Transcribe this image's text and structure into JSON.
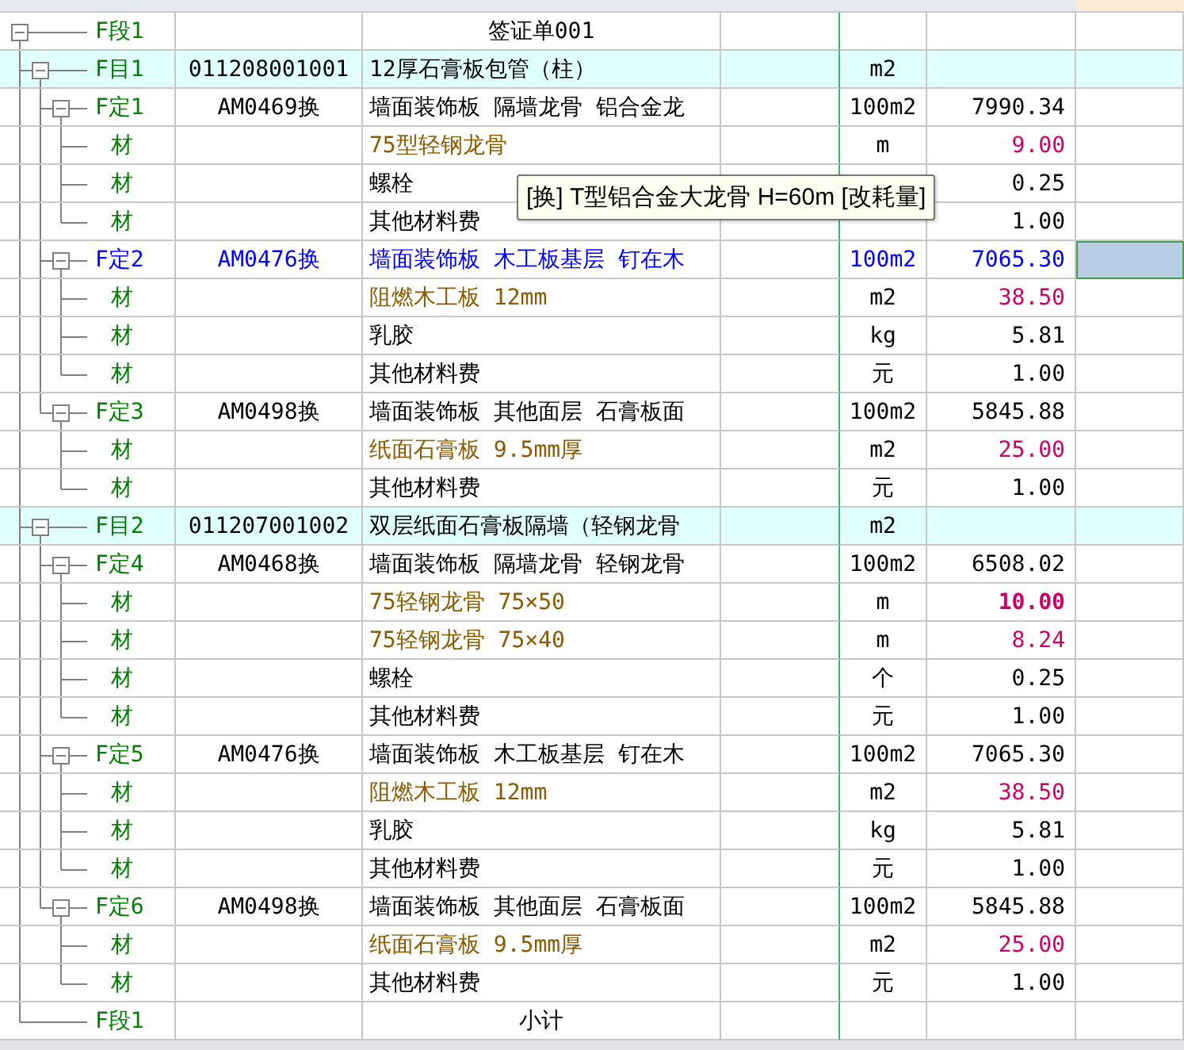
{
  "rows": [
    {
      "kind": "section",
      "label": "F段1",
      "name": "签证单001",
      "expanded": true,
      "selected": false,
      "children": [
        {
          "kind": "item",
          "label": "F目1",
          "code": "011208001001",
          "name": "12厚石膏板包管（柱）",
          "unit": "m2",
          "expanded": true,
          "selected": false,
          "children": [
            {
              "kind": "quota",
              "label": "F定1",
              "code": "AM0469换",
              "name": "墙面装饰板 隔墙龙骨 铝合金龙",
              "unit": "100m2",
              "price": "7990.34",
              "expanded": true,
              "selected": false,
              "children": [
                {
                  "kind": "material",
                  "label": "材",
                  "name": "75型轻钢龙骨",
                  "unit": "m",
                  "price": "9.00",
                  "modified": true,
                  "emphasized": false,
                  "selected": false
                },
                {
                  "kind": "material",
                  "label": "材",
                  "name": "螺栓",
                  "price": "0.25",
                  "modified": false,
                  "emphasized": false,
                  "selected": false
                },
                {
                  "kind": "material",
                  "label": "材",
                  "name": "其他材料费",
                  "price": "1.00",
                  "modified": false,
                  "emphasized": false,
                  "selected": false
                }
              ]
            },
            {
              "kind": "quota",
              "label": "F定2",
              "code": "AM0476换",
              "name": "墙面装饰板 木工板基层 钉在木",
              "unit": "100m2",
              "price": "7065.30",
              "expanded": true,
              "selected": true,
              "children": [
                {
                  "kind": "material",
                  "label": "材",
                  "name": "阻燃木工板 12mm",
                  "unit": "m2",
                  "price": "38.50",
                  "modified": true,
                  "emphasized": false,
                  "selected": false
                },
                {
                  "kind": "material",
                  "label": "材",
                  "name": "乳胶",
                  "unit": "kg",
                  "price": "5.81",
                  "modified": false,
                  "emphasized": false,
                  "selected": false
                },
                {
                  "kind": "material",
                  "label": "材",
                  "name": "其他材料费",
                  "unit": "元",
                  "price": "1.00",
                  "modified": false,
                  "emphasized": false,
                  "selected": false
                }
              ]
            },
            {
              "kind": "quota",
              "label": "F定3",
              "code": "AM0498换",
              "name": "墙面装饰板 其他面层 石膏板面",
              "unit": "100m2",
              "price": "5845.88",
              "expanded": true,
              "selected": false,
              "children": [
                {
                  "kind": "material",
                  "label": "材",
                  "name": "纸面石膏板 9.5mm厚",
                  "unit": "m2",
                  "price": "25.00",
                  "modified": true,
                  "emphasized": false,
                  "selected": false
                },
                {
                  "kind": "material",
                  "label": "材",
                  "name": "其他材料费",
                  "unit": "元",
                  "price": "1.00",
                  "modified": false,
                  "emphasized": false,
                  "selected": false
                }
              ]
            }
          ]
        },
        {
          "kind": "item",
          "label": "F目2",
          "code": "011207001002",
          "name": "双层纸面石膏板隔墙（轻钢龙骨",
          "unit": "m2",
          "expanded": true,
          "selected": false,
          "children": [
            {
              "kind": "quota",
              "label": "F定4",
              "code": "AM0468换",
              "name": "墙面装饰板 隔墙龙骨 轻钢龙骨",
              "unit": "100m2",
              "price": "6508.02",
              "expanded": true,
              "selected": false,
              "children": [
                {
                  "kind": "material",
                  "label": "材",
                  "name": "75轻钢龙骨 75×50",
                  "unit": "m",
                  "price": "10.00",
                  "modified": true,
                  "emphasized": true,
                  "selected": false
                },
                {
                  "kind": "material",
                  "label": "材",
                  "name": "75轻钢龙骨 75×40",
                  "unit": "m",
                  "price": "8.24",
                  "modified": true,
                  "emphasized": false,
                  "selected": false
                },
                {
                  "kind": "material",
                  "label": "材",
                  "name": "螺栓",
                  "unit": "个",
                  "price": "0.25",
                  "modified": false,
                  "emphasized": false,
                  "selected": false
                },
                {
                  "kind": "material",
                  "label": "材",
                  "name": "其他材料费",
                  "unit": "元",
                  "price": "1.00",
                  "modified": false,
                  "emphasized": false,
                  "selected": false
                }
              ]
            },
            {
              "kind": "quota",
              "label": "F定5",
              "code": "AM0476换",
              "name": "墙面装饰板 木工板基层 钉在木",
              "unit": "100m2",
              "price": "7065.30",
              "expanded": true,
              "selected": false,
              "children": [
                {
                  "kind": "material",
                  "label": "材",
                  "name": "阻燃木工板 12mm",
                  "unit": "m2",
                  "price": "38.50",
                  "modified": true,
                  "emphasized": false,
                  "selected": false
                },
                {
                  "kind": "material",
                  "label": "材",
                  "name": "乳胶",
                  "unit": "kg",
                  "price": "5.81",
                  "modified": false,
                  "emphasized": false,
                  "selected": false
                },
                {
                  "kind": "material",
                  "label": "材",
                  "name": "其他材料费",
                  "unit": "元",
                  "price": "1.00",
                  "modified": false,
                  "emphasized": false,
                  "selected": false
                }
              ]
            },
            {
              "kind": "quota",
              "label": "F定6",
              "code": "AM0498换",
              "name": "墙面装饰板 其他面层 石膏板面",
              "unit": "100m2",
              "price": "5845.88",
              "expanded": true,
              "selected": false,
              "children": [
                {
                  "kind": "material",
                  "label": "材",
                  "name": "纸面石膏板 9.5mm厚",
                  "unit": "m2",
                  "price": "25.00",
                  "modified": true,
                  "emphasized": false,
                  "selected": false
                },
                {
                  "kind": "material",
                  "label": "材",
                  "name": "其他材料费",
                  "unit": "元",
                  "price": "1.00",
                  "modified": false,
                  "emphasized": false,
                  "selected": false
                }
              ]
            }
          ]
        },
        {
          "kind": "section",
          "label": "F段1",
          "name": "小计",
          "selected": false
        }
      ]
    }
  ],
  "tooltip": "[换] T型铝合金大龙骨 H=60m [改耗量]"
}
